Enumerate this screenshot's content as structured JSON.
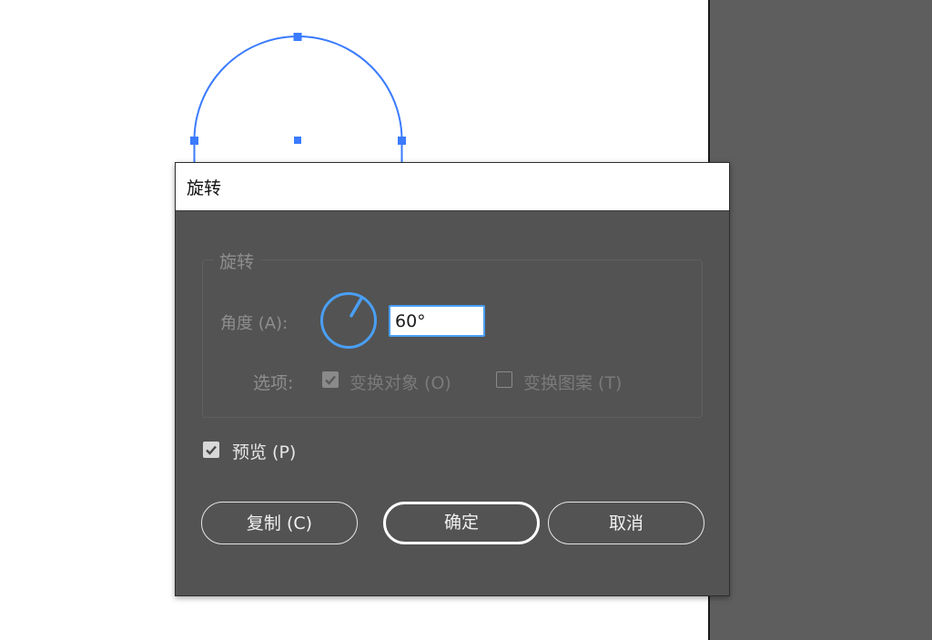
{
  "canvas": {
    "background": "#ffffff",
    "shape_stroke_color": "#3a7bff",
    "anchor_color": "#3a7bff"
  },
  "pasteboard": {
    "background": "#5e5e5e"
  },
  "dialog": {
    "title": "旋转",
    "rotate_group": {
      "legend": "旋转",
      "angle_label": "角度 (A):",
      "angle_value": "60°",
      "angle_degrees": 60,
      "dial_color": "#4a9ff5",
      "options_label": "选项:",
      "transform_objects": {
        "label": "变换对象 (O)",
        "checked": true,
        "enabled": false
      },
      "transform_patterns": {
        "label": "变换图案 (T)",
        "checked": false,
        "enabled": false
      }
    },
    "preview": {
      "label": "预览 (P)",
      "checked": true
    },
    "buttons": {
      "copy": "复制 (C)",
      "ok": "确定",
      "cancel": "取消"
    }
  }
}
